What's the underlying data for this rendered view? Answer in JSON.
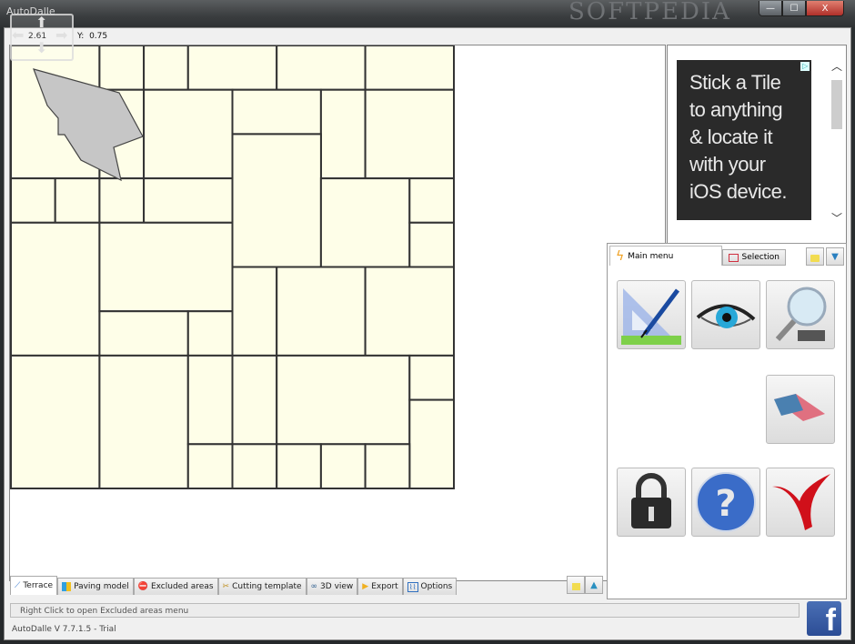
{
  "window": {
    "title": "AutoDalle",
    "watermark": "SOFTPEDIA",
    "controls": {
      "minimize": "—",
      "maximize": "☐",
      "close": "X"
    }
  },
  "coords": {
    "x_label": "2.61",
    "y_label": "Y:",
    "y_value": "0.75"
  },
  "canvas": {
    "tile_color": "#fefee8",
    "unit_grid": [
      10,
      10
    ],
    "tiles": [
      [
        0,
        0,
        2,
        3
      ],
      [
        2,
        0,
        1,
        1
      ],
      [
        3,
        0,
        1,
        1
      ],
      [
        4,
        0,
        2,
        1
      ],
      [
        6,
        0,
        2,
        1
      ],
      [
        8,
        0,
        2,
        1
      ],
      [
        2,
        1,
        1,
        2
      ],
      [
        3,
        1,
        2,
        2
      ],
      [
        5,
        1,
        2,
        1
      ],
      [
        7,
        1,
        1,
        2
      ],
      [
        8,
        1,
        2,
        2
      ],
      [
        5,
        2,
        2,
        3
      ],
      [
        0,
        3,
        1,
        1
      ],
      [
        1,
        3,
        1,
        1
      ],
      [
        2,
        3,
        1,
        1
      ],
      [
        3,
        3,
        2,
        1
      ],
      [
        7,
        3,
        2,
        2
      ],
      [
        9,
        3,
        1,
        1
      ],
      [
        0,
        4,
        2,
        3
      ],
      [
        2,
        4,
        3,
        2
      ],
      [
        9,
        4,
        1,
        1
      ],
      [
        5,
        5,
        1,
        2
      ],
      [
        6,
        5,
        2,
        2
      ],
      [
        8,
        5,
        2,
        2
      ],
      [
        2,
        6,
        2,
        1
      ],
      [
        4,
        6,
        1,
        1
      ],
      [
        0,
        7,
        2,
        3
      ],
      [
        2,
        7,
        2,
        3
      ],
      [
        4,
        7,
        1,
        2
      ],
      [
        5,
        7,
        1,
        2
      ],
      [
        6,
        7,
        3,
        2
      ],
      [
        9,
        7,
        1,
        1
      ],
      [
        9,
        8,
        1,
        2
      ],
      [
        4,
        9,
        1,
        1
      ],
      [
        5,
        9,
        1,
        1
      ],
      [
        6,
        9,
        1,
        1
      ],
      [
        7,
        9,
        1,
        1
      ],
      [
        8,
        9,
        1,
        1
      ]
    ],
    "excluded_area_color": "#c6c6c6"
  },
  "ad": {
    "lines": [
      "Stick a Tile",
      "to anything",
      "& locate it",
      "with your",
      "iOS device."
    ],
    "choice_icon": "▷"
  },
  "tools_panel": {
    "tabs": [
      {
        "label": "Main menu",
        "icon": "lightning-icon",
        "active": true
      },
      {
        "label": "Selection",
        "icon": "selection-rect-icon",
        "active": false
      }
    ],
    "buttons": [
      {
        "name": "draw-button",
        "icon": "ruler-pen-icon"
      },
      {
        "name": "view-button",
        "icon": "eye-icon"
      },
      {
        "name": "zoom-button",
        "icon": "magnifier-icon"
      },
      {
        "name": "erase-button",
        "icon": "eraser-icon"
      },
      {
        "name": "lock-button",
        "icon": "padlock-icon"
      },
      {
        "name": "help-button",
        "icon": "help-icon"
      },
      {
        "name": "exit-button",
        "icon": "red-x-icon"
      }
    ]
  },
  "bottom_tabs": [
    {
      "label": "Terrace",
      "icon": "terrace-icon",
      "active": true
    },
    {
      "label": "Paving model",
      "icon": "paving-icon",
      "active": false
    },
    {
      "label": "Excluded areas",
      "icon": "no-entry-icon",
      "active": false
    },
    {
      "label": "Cutting template",
      "icon": "scissors-icon",
      "active": false
    },
    {
      "label": "3D view",
      "icon": "3d-icon",
      "active": false
    },
    {
      "label": "Export",
      "icon": "export-icon",
      "active": false
    },
    {
      "label": "Options",
      "icon": "options-icon",
      "active": false
    }
  ],
  "status": {
    "message": "Right Click to open Excluded areas menu",
    "version": "AutoDalle  V 7.7.1.5 - Trial"
  },
  "facebook": {
    "label": "f"
  }
}
